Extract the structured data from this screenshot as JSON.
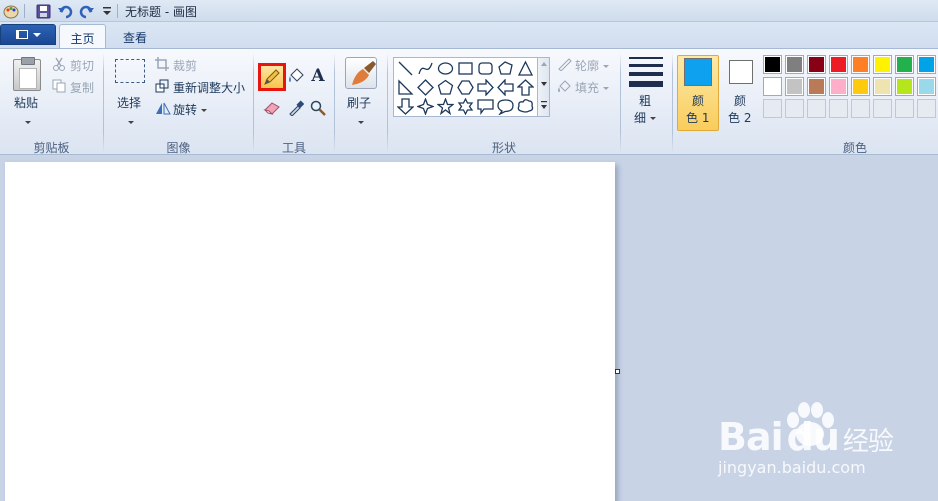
{
  "window": {
    "title": "无标题 - 画图"
  },
  "quick_access": {
    "icons": [
      "app-icon",
      "save-icon",
      "undo-icon",
      "redo-icon",
      "customize-icon"
    ]
  },
  "tabs": [
    {
      "label": "主页",
      "active": true
    },
    {
      "label": "查看",
      "active": false
    }
  ],
  "ribbon": {
    "clipboard": {
      "group_label": "剪贴板",
      "paste_label": "粘贴",
      "cut_label": "剪切",
      "copy_label": "复制"
    },
    "image": {
      "group_label": "图像",
      "select_label": "选择",
      "crop_label": "裁剪",
      "resize_label": "重新调整大小",
      "rotate_label": "旋转"
    },
    "tools": {
      "group_label": "工具",
      "selected": "pencil",
      "highlight_color": "#e8150f"
    },
    "brushes": {
      "label": "刷子"
    },
    "shapes": {
      "group_label": "形状",
      "outline_label": "轮廓",
      "fill_label": "填充"
    },
    "size": {
      "label_line1": "粗",
      "label_line2": "细"
    },
    "colors": {
      "group_label": "颜色",
      "color1_line1": "颜",
      "color1_line2": "色 1",
      "color1_value": "#0ea1f0",
      "color2_line1": "颜",
      "color2_line2": "色 2",
      "color2_value": "#ffffff",
      "palette_row1": [
        "#000000",
        "#7f7f7f",
        "#880015",
        "#ed1c24",
        "#ff7f27",
        "#fff200",
        "#22b14c",
        "#00a2e8"
      ],
      "palette_row2": [
        "#ffffff",
        "#c3c3c3",
        "#b97a57",
        "#ffaec9",
        "#ffc90e",
        "#efe4b0",
        "#b5e61d",
        "#99d9ea"
      ]
    }
  },
  "watermark": {
    "logo_left": "Bai",
    "logo_right": "du",
    "logo_cn": "经验",
    "url": "jingyan.baidu.com"
  }
}
